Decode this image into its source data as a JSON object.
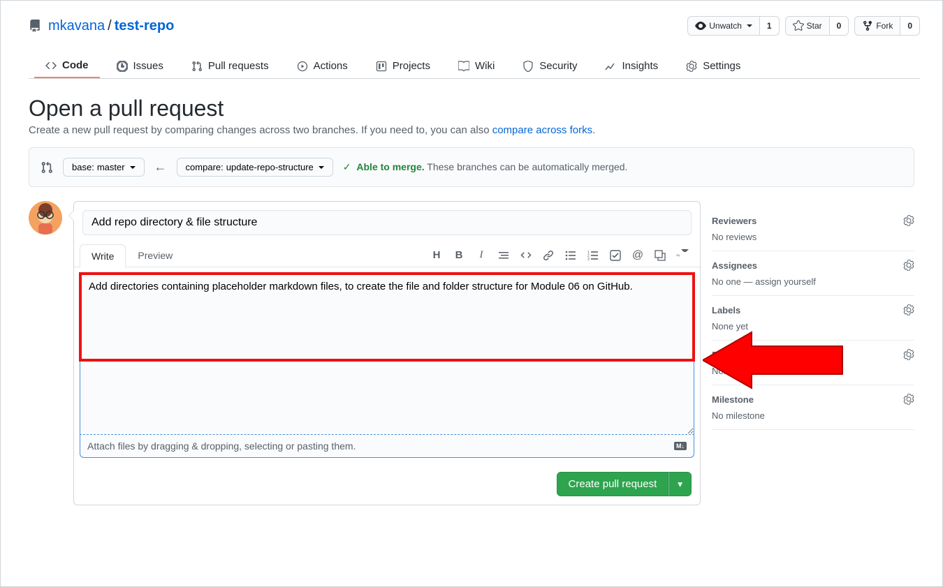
{
  "repo": {
    "owner": "mkavana",
    "name": "test-repo"
  },
  "actions": {
    "watch": {
      "label": "Unwatch",
      "count": "1"
    },
    "star": {
      "label": "Star",
      "count": "0"
    },
    "fork": {
      "label": "Fork",
      "count": "0"
    }
  },
  "tabs": {
    "code": "Code",
    "issues": "Issues",
    "pulls": "Pull requests",
    "actions": "Actions",
    "projects": "Projects",
    "wiki": "Wiki",
    "security": "Security",
    "insights": "Insights",
    "settings": "Settings"
  },
  "page": {
    "title": "Open a pull request",
    "subtitle_pre": "Create a new pull request by comparing changes across two branches. If you need to, you can also ",
    "subtitle_link": "compare across forks"
  },
  "range": {
    "base_label": "base: ",
    "base_branch": "master",
    "compare_label": "compare: ",
    "compare_branch": "update-repo-structure",
    "able": "Able to merge.",
    "merge_text": "These branches can be automatically merged."
  },
  "form": {
    "title_value": "Add repo directory & file structure",
    "tab_write": "Write",
    "tab_preview": "Preview",
    "body_value": "Add directories containing placeholder markdown files, to create the file and folder structure for Module 06 on GitHub.",
    "attach_text": "Attach files by dragging & dropping, selecting or pasting them.",
    "submit": "Create pull request"
  },
  "sidebar": {
    "reviewers": {
      "title": "Reviewers",
      "value": "No reviews"
    },
    "assignees": {
      "title": "Assignees",
      "value": "No one — assign yourself"
    },
    "labels": {
      "title": "Labels",
      "value": "None yet"
    },
    "projects": {
      "title": "Projects",
      "value": "None yet"
    },
    "milestone": {
      "title": "Milestone",
      "value": "No milestone"
    }
  }
}
